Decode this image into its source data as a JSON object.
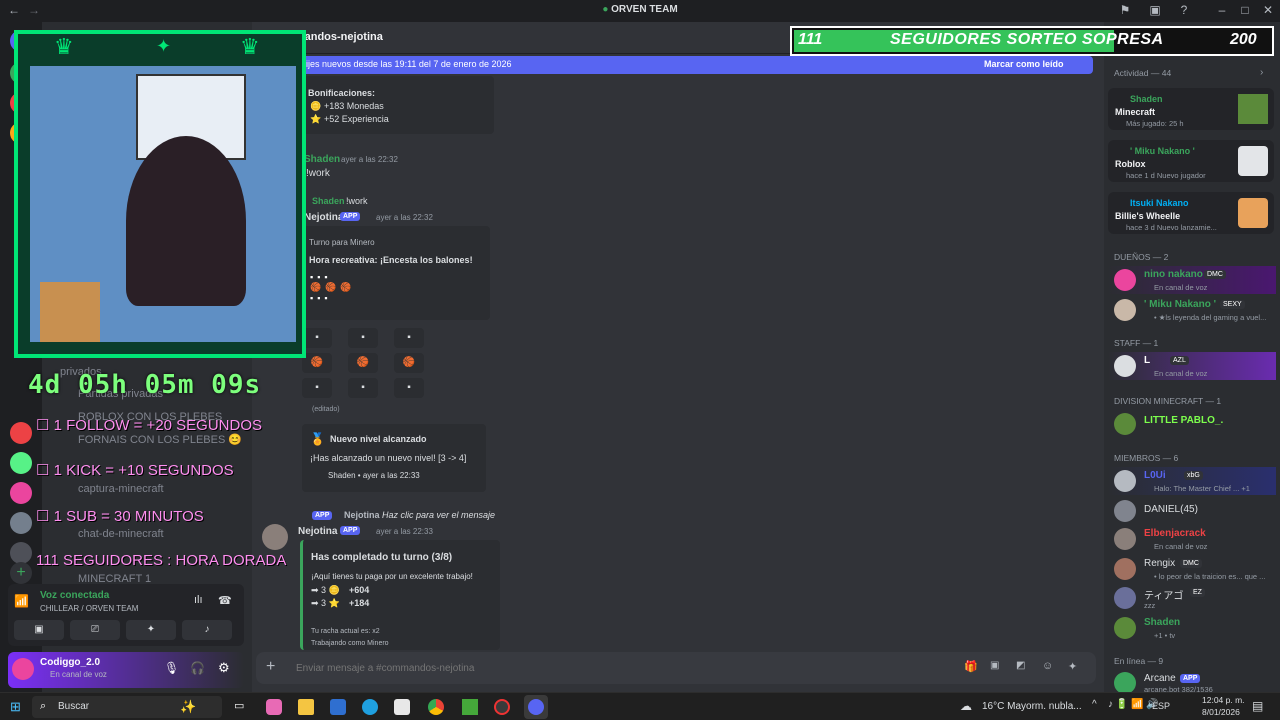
{
  "window": {
    "title": "ORVEN TEAM"
  },
  "channel": {
    "name": "comandos-nejotina",
    "server_name": "ORVEN TEAM"
  },
  "banner": {
    "text": "ijes nuevos desde las 19:11 del 7 de enero de 2026",
    "action": "Marcar como leído"
  },
  "follow_goal": {
    "current": "111",
    "label": "SEGUIDORES SORTEO SOPRESA",
    "goal": "200",
    "progress": 0.555
  },
  "timer": "4d 05h 05m 09s",
  "rules": [
    "☐ 1 FOLLOW = +20 SEGUNDOS",
    "☐ 1 KICK = +10 SEGUNDOS",
    "☐ 1 SUB = 30 MINUTOS",
    "111 SEGUIDORES : HORA DORADA"
  ],
  "sidebar_channels": [
    {
      "name": "privados"
    },
    {
      "name": "Partidas privadas"
    },
    {
      "name": "ROBLOX CON LOS PLEBES"
    },
    {
      "name": "FORNAIS CON LOS PLEBES 😊"
    },
    {
      "name": "captura-minecraft"
    },
    {
      "name": "chat-de-minecraft"
    },
    {
      "name": "MINECRAFT 1"
    }
  ],
  "voice": {
    "status": "Voz conectada",
    "channel": "CHILLEAR / ORVEN TEAM"
  },
  "user": {
    "name": "Codiggo_2.0",
    "status": "En canal de voz"
  },
  "messages": {
    "bonus_title": "Bonificaciones:",
    "bonus_coins": "+183 Monedas",
    "bonus_xp": "+52 Experiencia",
    "m1_author": "Shaden",
    "m1_time": "ayer a las 22:32",
    "m1_text": "!work",
    "m2_reply_author": "Shaden",
    "m2_reply_text": "!work",
    "m2_author": "Nejotina",
    "m2_badge": "APP",
    "m2_time": "ayer a las 22:32",
    "turn_label": "Turno para Minero",
    "turn_title": "Hora recreativa: ¡Encesta los balones!",
    "edited": "(editado)",
    "level_title": "Nuevo nivel alcanzado",
    "level_text": "¡Has alcanzado un nuevo nivel! [3 -> 4]",
    "level_footer": "Shaden • ayer a las 22:33",
    "m3_reply_badge": "APP",
    "m3_reply_author": "Nejotina",
    "m3_reply_text": "Haz clic para ver el mensaje",
    "m3_author": "Nejotina",
    "m3_badge": "APP",
    "m3_time": "ayer a las 22:33",
    "shift_title": "Has completado tu turno (3/8)",
    "shift_text": "¡Aquí tienes tu paga por un excelente trabajo!",
    "shift_coins": "+604",
    "shift_xp": "+184",
    "shift_streak": "Tu racha actual es: x2",
    "shift_job": "Trabajando como Minero"
  },
  "composer": {
    "placeholder": "Enviar mensaje a #commandos-nejotina"
  },
  "members": {
    "activity_header": "Actividad — 44",
    "activities": [
      {
        "user": "Shaden",
        "game": "Minecraft",
        "detail": "Más jugado: 25 h"
      },
      {
        "user": "' Miku Nakano '",
        "game": "Roblox",
        "detail": "hace 1 d   Nuevo jugador"
      },
      {
        "user": "Itsuki Nakano",
        "game": "Billie's Wheelle",
        "detail": "hace 3 d   Nuevo lanzamie..."
      }
    ],
    "owners_header": "DUEÑOS — 2",
    "owners": [
      {
        "name": "nino nakano",
        "tag": "DMC",
        "status": "En canal de voz",
        "color": "#3ba55c"
      },
      {
        "name": "' Miku Nakano '",
        "tag": "SEXY",
        "status": "• ★ls leyenda del gaming a vuel...",
        "color": "#3ba55c"
      }
    ],
    "staff_header": "STAFF — 1",
    "staff": [
      {
        "name": "L",
        "tag": "AZL",
        "status": "En canal de voz",
        "color": "#ffffff"
      }
    ],
    "division_header": "DIVISION MINECRAFT — 1",
    "division": [
      {
        "name": "LITTLE PABLO_.",
        "status": "",
        "color": "#7dff4d"
      }
    ],
    "members_header": "MIEMBROS — 6",
    "members_list": [
      {
        "name": "L0Ui",
        "tag": "xbG",
        "status": "Halo: The Master Chief ... +1",
        "color": "#5865f2"
      },
      {
        "name": "DANIEL(45)",
        "tag": "",
        "status": "",
        "color": "#dbdee1"
      },
      {
        "name": "Elbenjacrack",
        "tag": "",
        "status": "En canal de voz",
        "color": "#ed4245"
      },
      {
        "name": "Rengix",
        "tag": "DMC",
        "status": "• lo peor de la traicion es... que ...",
        "color": "#dbdee1"
      },
      {
        "name": "ティアゴ",
        "tag": "EZ",
        "status": "zzz",
        "color": "#dbdee1"
      },
      {
        "name": "Shaden",
        "tag": "",
        "status": "+1 • tv",
        "color": "#3ba55c"
      }
    ],
    "online_header": "En línea — 9",
    "online": [
      {
        "name": "Arcane",
        "tag": "APP",
        "status": "arcane.bot 382/1536",
        "color": "#dbdee1"
      }
    ]
  },
  "taskbar": {
    "search": "Buscar",
    "weather": "16°C  Mayorm. nubla...",
    "lang": "ESP",
    "time": "12:04 p. m.",
    "date": "8/01/2026"
  },
  "colors": {
    "accent": "#5865f2",
    "green": "#3ba55c",
    "overlay_green": "#00e676",
    "overlay_pink": "#ff8ff0"
  }
}
